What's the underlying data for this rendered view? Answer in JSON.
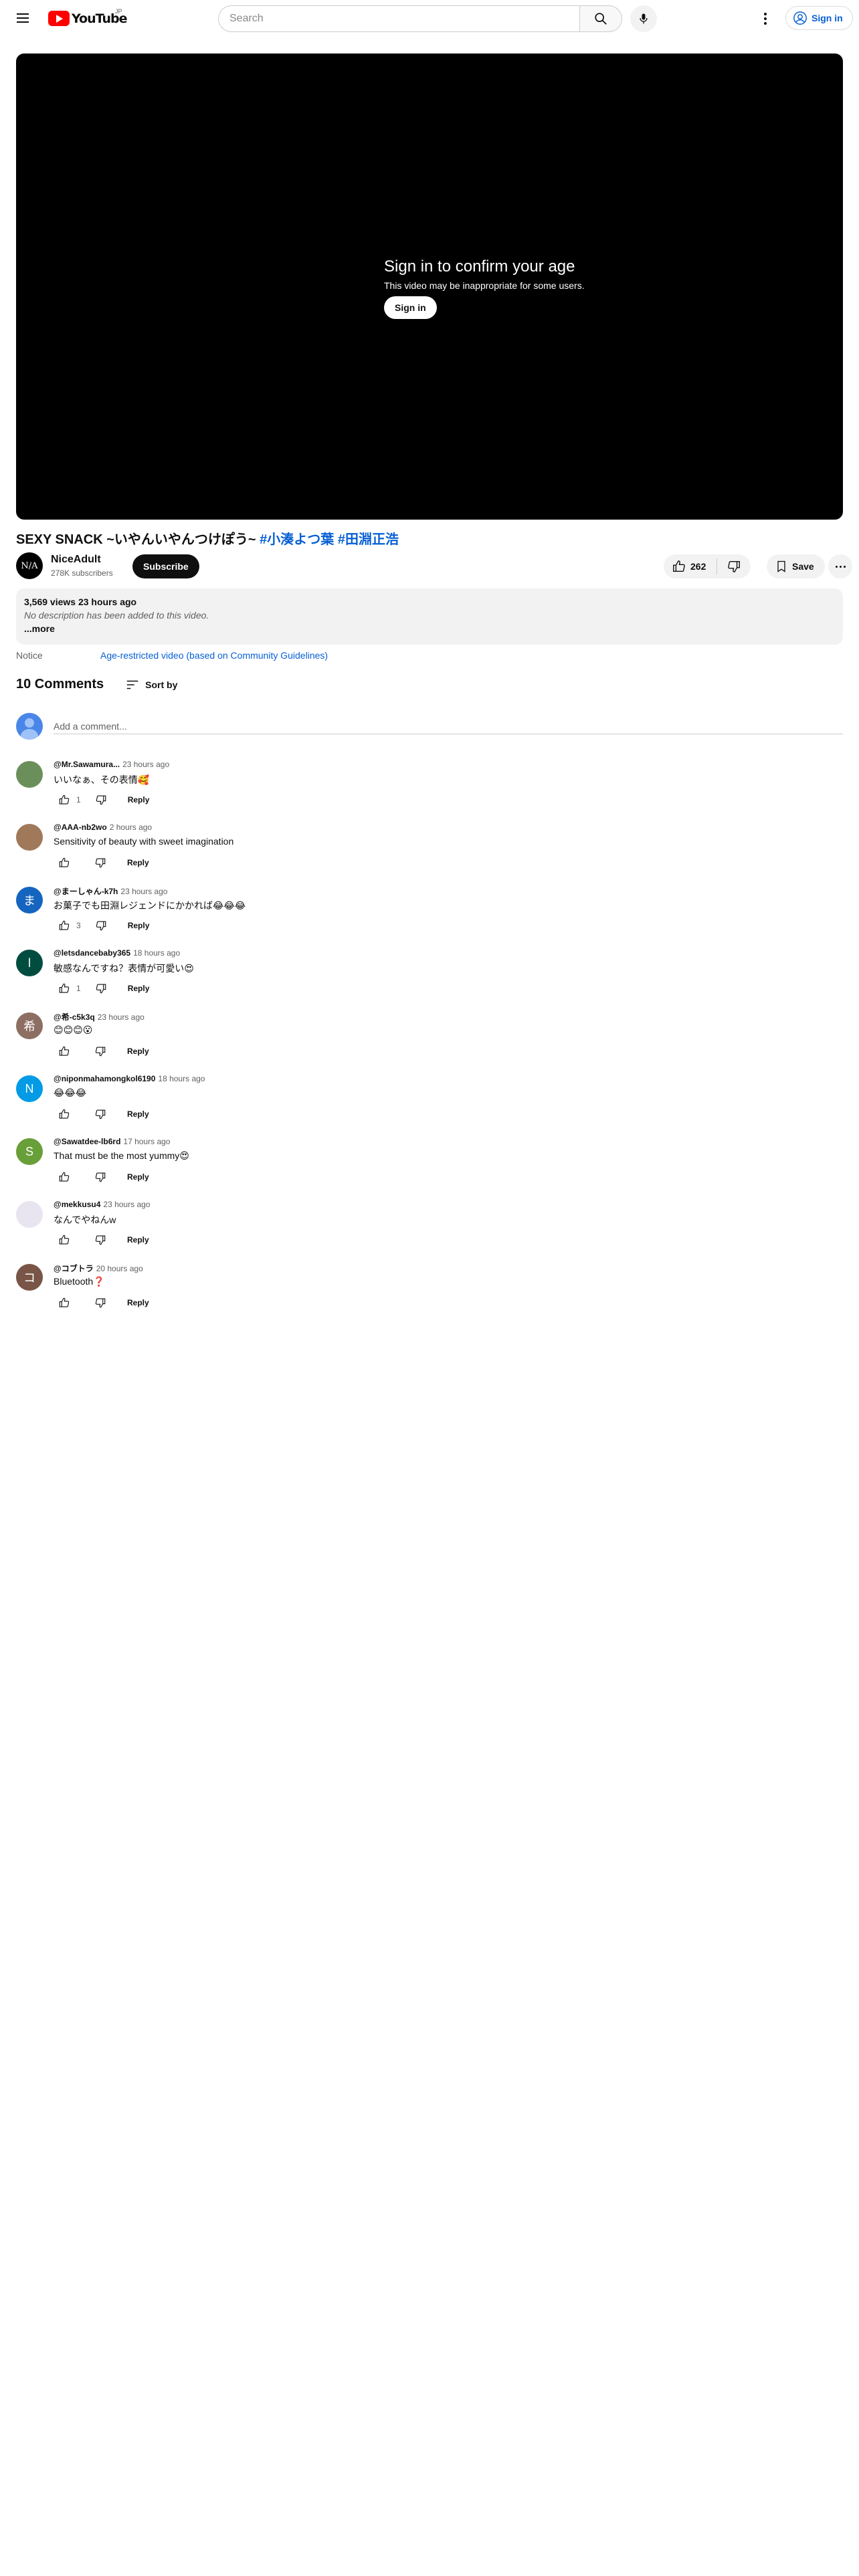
{
  "header": {
    "logo_text": "YouTube",
    "logo_country": "JP",
    "search_placeholder": "Search",
    "signin_label": "Sign in"
  },
  "player": {
    "age_title": "Sign in to confirm your age",
    "age_subtitle": "This video may be inappropriate for some users.",
    "signin_label": "Sign in"
  },
  "video": {
    "title_main": "SEXY SNACK ~いやんいやんつけぽう~ ",
    "hashtag1": "#小湊よつ葉",
    "hashtag2": "#田淵正浩",
    "channel_avatar_text": "N/A",
    "channel_name": "NiceAdult",
    "subscribers": "278K subscribers",
    "subscribe_label": "Subscribe",
    "likes": "262",
    "save_label": "Save"
  },
  "description": {
    "stats": "3,569 views  23 hours ago",
    "body": "No description has been added to this video.",
    "more_label": "...more"
  },
  "notice": {
    "label": "Notice",
    "link": "Age-restricted video (based on Community Guidelines)"
  },
  "comments_section": {
    "count_label": "10 Comments",
    "sort_label": "Sort by",
    "add_placeholder": "Add a comment..."
  },
  "comments": [
    {
      "author": "@Mr.Sawamura...",
      "time": "23 hours ago",
      "text": "いいなぁ、その表情🥰",
      "likes": "1",
      "avatar": "",
      "avatar_color": "#6b8f5a",
      "reply_label": "Reply"
    },
    {
      "author": "@AAA-nb2wo",
      "time": "2 hours ago",
      "text": "Sensitivity of beauty with sweet imagination",
      "likes": "",
      "avatar": "",
      "avatar_color": "#a0785a",
      "reply_label": "Reply"
    },
    {
      "author": "@まーしゃん-k7h",
      "time": "23 hours ago",
      "text": "お菓子でも田淵レジェンドにかかれば😂😂😂",
      "likes": "3",
      "avatar": "ま",
      "avatar_color": "#1565c0",
      "reply_label": "Reply"
    },
    {
      "author": "@letsdancebaby365",
      "time": "18 hours ago",
      "text": "敏感なんですね？表情が可愛い😍",
      "likes": "1",
      "avatar": "l",
      "avatar_color": "#004d40",
      "reply_label": "Reply"
    },
    {
      "author": "@希-c5k3q",
      "time": "23 hours ago",
      "text": "😊😊😊😮",
      "likes": "",
      "avatar": "希",
      "avatar_color": "#8d6e63",
      "reply_label": "Reply"
    },
    {
      "author": "@niponmahamongkol6190",
      "time": "18 hours ago",
      "text": "😂😂😂",
      "likes": "",
      "avatar": "N",
      "avatar_color": "#039be5",
      "reply_label": "Reply"
    },
    {
      "author": "@Sawatdee-lb6rd",
      "time": "17 hours ago",
      "text": "That must be the most yummy😍",
      "likes": "",
      "avatar": "S",
      "avatar_color": "#689f38",
      "reply_label": "Reply"
    },
    {
      "author": "@mekkusu4",
      "time": "23 hours ago",
      "text": "なんでやねんw",
      "likes": "",
      "avatar": "",
      "avatar_color": "#e8e4f0",
      "reply_label": "Reply"
    },
    {
      "author": "@コブトラ",
      "time": "20 hours ago",
      "text": "Bluetooth❓",
      "likes": "",
      "avatar": "コ",
      "avatar_color": "#795548",
      "reply_label": "Reply"
    }
  ],
  "colors": {
    "accent_link": "#065fd4",
    "brand_red": "#ff0000",
    "chip_bg": "#f2f2f2"
  }
}
